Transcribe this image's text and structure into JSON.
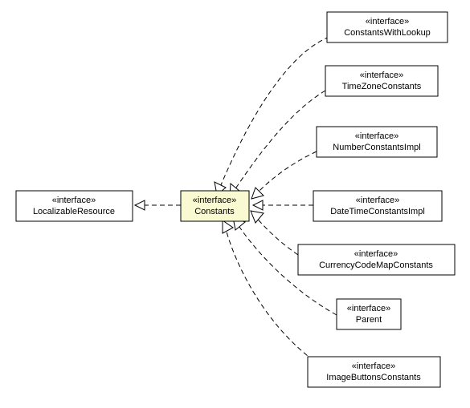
{
  "stereotype": "«interface»",
  "nodes": {
    "localizable": {
      "name": "LocalizableResource"
    },
    "constants": {
      "name": "Constants"
    },
    "cwl": {
      "name": "ConstantsWithLookup"
    },
    "tz": {
      "name": "TimeZoneConstants"
    },
    "num": {
      "name": "NumberConstantsImpl"
    },
    "dt": {
      "name": "DateTimeConstantsImpl"
    },
    "curr": {
      "name": "CurrencyCodeMapConstants"
    },
    "parent": {
      "name": "Parent"
    },
    "img": {
      "name": "ImageButtonsConstants"
    }
  },
  "chart_data": {
    "type": "uml-class-diagram",
    "title": "",
    "interfaces": [
      "LocalizableResource",
      "Constants",
      "ConstantsWithLookup",
      "TimeZoneConstants",
      "NumberConstantsImpl",
      "DateTimeConstantsImpl",
      "CurrencyCodeMapConstants",
      "Parent",
      "ImageButtonsConstants"
    ],
    "relationships": [
      {
        "from": "Constants",
        "to": "LocalizableResource",
        "type": "realization"
      },
      {
        "from": "ConstantsWithLookup",
        "to": "Constants",
        "type": "realization"
      },
      {
        "from": "TimeZoneConstants",
        "to": "Constants",
        "type": "realization"
      },
      {
        "from": "NumberConstantsImpl",
        "to": "Constants",
        "type": "realization"
      },
      {
        "from": "DateTimeConstantsImpl",
        "to": "Constants",
        "type": "realization"
      },
      {
        "from": "CurrencyCodeMapConstants",
        "to": "Constants",
        "type": "realization"
      },
      {
        "from": "Parent",
        "to": "Constants",
        "type": "realization"
      },
      {
        "from": "ImageButtonsConstants",
        "to": "Constants",
        "type": "realization"
      }
    ]
  }
}
